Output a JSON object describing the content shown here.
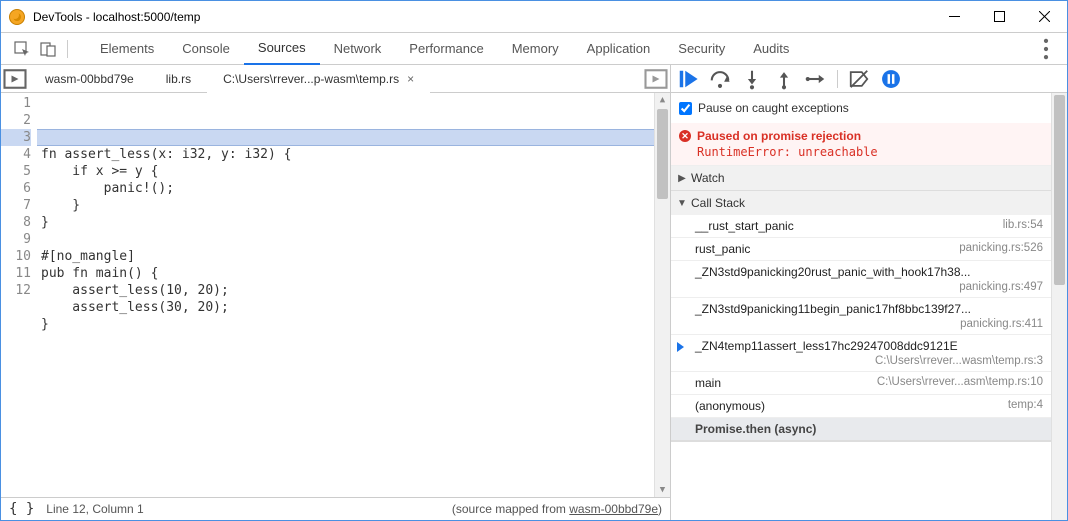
{
  "window": {
    "title": "DevTools - localhost:5000/temp"
  },
  "nav": {
    "tabs": [
      "Elements",
      "Console",
      "Sources",
      "Network",
      "Performance",
      "Memory",
      "Application",
      "Security",
      "Audits"
    ],
    "active_index": 2
  },
  "file_tabs": {
    "items": [
      {
        "label": "wasm-00bbd79e"
      },
      {
        "label": "lib.rs"
      },
      {
        "label": "C:\\Users\\rrever...p-wasm\\temp.rs"
      }
    ],
    "active_index": 2
  },
  "code": {
    "lines": [
      "fn assert_less(x: i32, y: i32) {",
      "    if x >= y {",
      "        panic!();",
      "    }",
      "}",
      "",
      "#[no_mangle]",
      "pub fn main() {",
      "    assert_less(10, 20);",
      "    assert_less(30, 20);",
      "}",
      ""
    ],
    "highlighted_line_index": 2
  },
  "status": {
    "cursor": "Line 12, Column 1",
    "source_map_prefix": "(source mapped from ",
    "source_map_link": "wasm-00bbd79e",
    "source_map_suffix": ")"
  },
  "debugger": {
    "pause_on_caught": "Pause on caught exceptions",
    "paused_label": "Paused on promise rejection",
    "paused_error": "RuntimeError: unreachable",
    "watch_label": "Watch",
    "call_stack_label": "Call Stack",
    "call_stack": [
      {
        "fn": "__rust_start_panic",
        "loc": "lib.rs:54",
        "twoline": false
      },
      {
        "fn": "rust_panic",
        "loc": "panicking.rs:526",
        "twoline": false
      },
      {
        "fn": "_ZN3std9panicking20rust_panic_with_hook17h38...",
        "loc": "panicking.rs:497",
        "twoline": true
      },
      {
        "fn": "_ZN3std9panicking11begin_panic17hf8bbc139f27...",
        "loc": "panicking.rs:411",
        "twoline": true
      },
      {
        "fn": "_ZN4temp11assert_less17hc29247008ddc9121E",
        "loc": "C:\\Users\\rrever...wasm\\temp.rs:3",
        "twoline": true,
        "current": true
      },
      {
        "fn": "main",
        "loc": "C:\\Users\\rrever...asm\\temp.rs:10",
        "twoline": false
      },
      {
        "fn": "(anonymous)",
        "loc": "temp:4",
        "twoline": false
      }
    ],
    "promise_label": "Promise.then (async)"
  }
}
